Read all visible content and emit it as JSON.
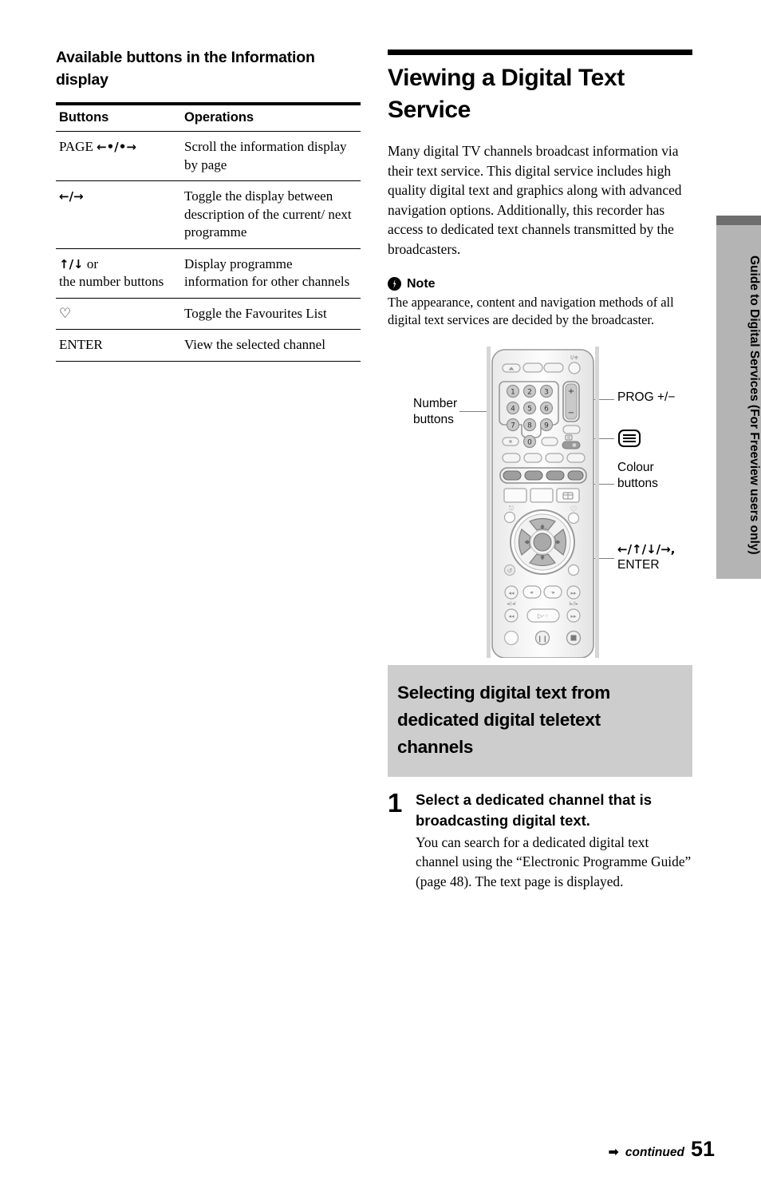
{
  "side_tab": {
    "label": "Guide to Digital Services (For Freeview users only)",
    "bg_color": "#b4b4b4",
    "cap_color": "#6e6e6e"
  },
  "left_column": {
    "section_heading": "Available buttons in the Information display",
    "table": {
      "headers": [
        "Buttons",
        "Operations"
      ],
      "rows": [
        {
          "button": "PAGE",
          "glyph": "←•/•→",
          "operation": "Scroll the information display by page"
        },
        {
          "button": "",
          "glyph": "←/→",
          "operation": "Toggle the display between description of the current/ next programme"
        },
        {
          "button": "",
          "glyph": "↑/↓",
          "glyph_suffix": " or",
          "button_extra": "the number buttons",
          "operation": "Display programme information for other channels"
        },
        {
          "button": "",
          "glyph": "♡",
          "operation": "Toggle the Favourites List"
        },
        {
          "button": "ENTER",
          "glyph": "",
          "operation": "View the selected channel"
        }
      ]
    }
  },
  "right_column": {
    "title": "Viewing a Digital Text Service",
    "intro": "Many digital TV channels broadcast information via their text service. This digital service includes high quality digital text and graphics along with advanced navigation options. Additionally, this recorder has access to dedicated text channels transmitted by the broadcasters.",
    "note": {
      "label": "Note",
      "text": "The appearance, content and navigation methods of all digital text services are decided by the broadcaster."
    },
    "diagram": {
      "callouts": {
        "number_buttons": "Number buttons",
        "prog": "PROG +/−",
        "teletext_icon": "teletext-icon",
        "colour_buttons": "Colour buttons",
        "arrows_enter_line1": "←/↑/↓/→,",
        "arrows_enter_line2": "ENTER"
      },
      "keypad_digits": [
        "1",
        "2",
        "3",
        "4",
        "5",
        "6",
        "7",
        "8",
        "9",
        "0"
      ],
      "prog_plus": "+",
      "prog_minus": "−"
    },
    "gray_heading": "Selecting digital text from dedicated digital teletext channels",
    "step": {
      "number": "1",
      "title": "Select a dedicated channel that is broadcasting digital text.",
      "text": "You can search for a dedicated digital text channel using the “Electronic Programme Guide” (page 48). The text page is displayed."
    }
  },
  "footer": {
    "continued_arrow": "➡",
    "continued_text": "continued",
    "page_number": "51"
  }
}
